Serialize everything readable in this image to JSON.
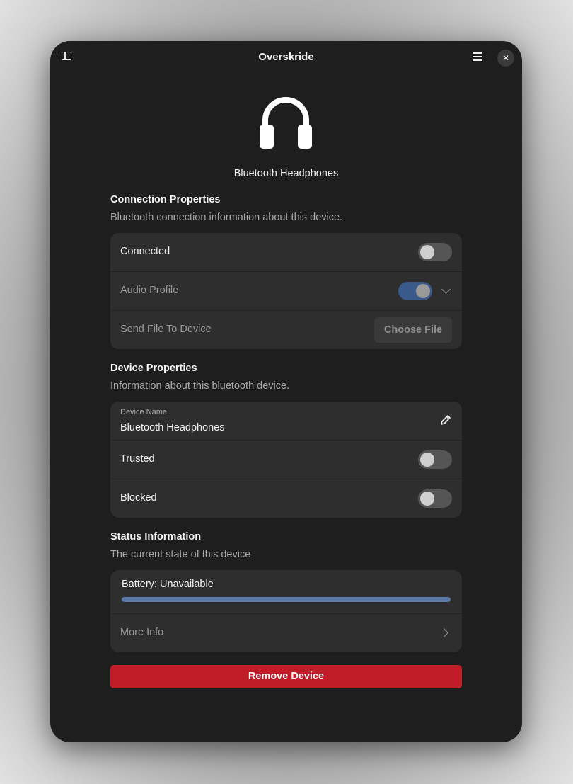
{
  "window": {
    "title": "Overskride"
  },
  "icons": {
    "sidebar_toggle": "sidebar-icon",
    "menu": "hamburger-menu-icon",
    "close": "close-icon",
    "device": "headphones-icon",
    "edit": "pencil-icon",
    "dropdown": "chevron-down-icon",
    "navigate": "chevron-right-icon"
  },
  "header": {
    "close_glyph": "✕"
  },
  "device": {
    "name": "Bluetooth Headphones"
  },
  "connection": {
    "title": "Connection Properties",
    "description": "Bluetooth connection information about this device.",
    "connected_label": "Connected",
    "connected": false,
    "audio_profile_label": "Audio Profile",
    "audio_profile_enabled": true,
    "send_file_label": "Send File To Device",
    "choose_file_label": "Choose File"
  },
  "device_props": {
    "title": "Device Properties",
    "description": "Information about this bluetooth device.",
    "name_field_label": "Device Name",
    "name_field_value": "Bluetooth Headphones",
    "trusted_label": "Trusted",
    "trusted": false,
    "blocked_label": "Blocked",
    "blocked": false
  },
  "status": {
    "title": "Status Information",
    "description": "The current state of this device",
    "battery_label": "Battery: Unavailable",
    "battery_fill_fraction": 1.0,
    "more_info_label": "More Info"
  },
  "actions": {
    "remove_label": "Remove Device"
  },
  "colors": {
    "window_bg": "#1e1e1e",
    "card_bg": "#2e2e2e",
    "accent": "#3a5a8c",
    "progress": "#5a78a8",
    "destructive": "#c01c28"
  }
}
